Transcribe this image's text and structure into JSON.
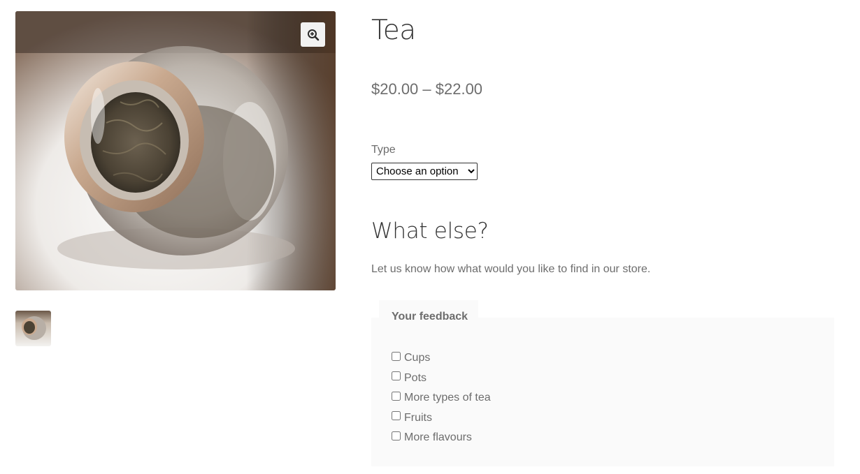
{
  "product": {
    "title": "Tea",
    "price": "$20.00 – $22.00"
  },
  "gallery": {
    "main_image": "tea-jar-photo",
    "zoom_icon": "zoom-in-icon"
  },
  "variation": {
    "label": "Type",
    "select_value": "Choose an option"
  },
  "extra": {
    "heading": "What else?",
    "description": "Let us know how what would you like to find in our store."
  },
  "feedback": {
    "legend": "Your feedback",
    "options": [
      "Cups",
      "Pots",
      "More types of tea",
      "Fruits",
      "More flavours"
    ]
  }
}
